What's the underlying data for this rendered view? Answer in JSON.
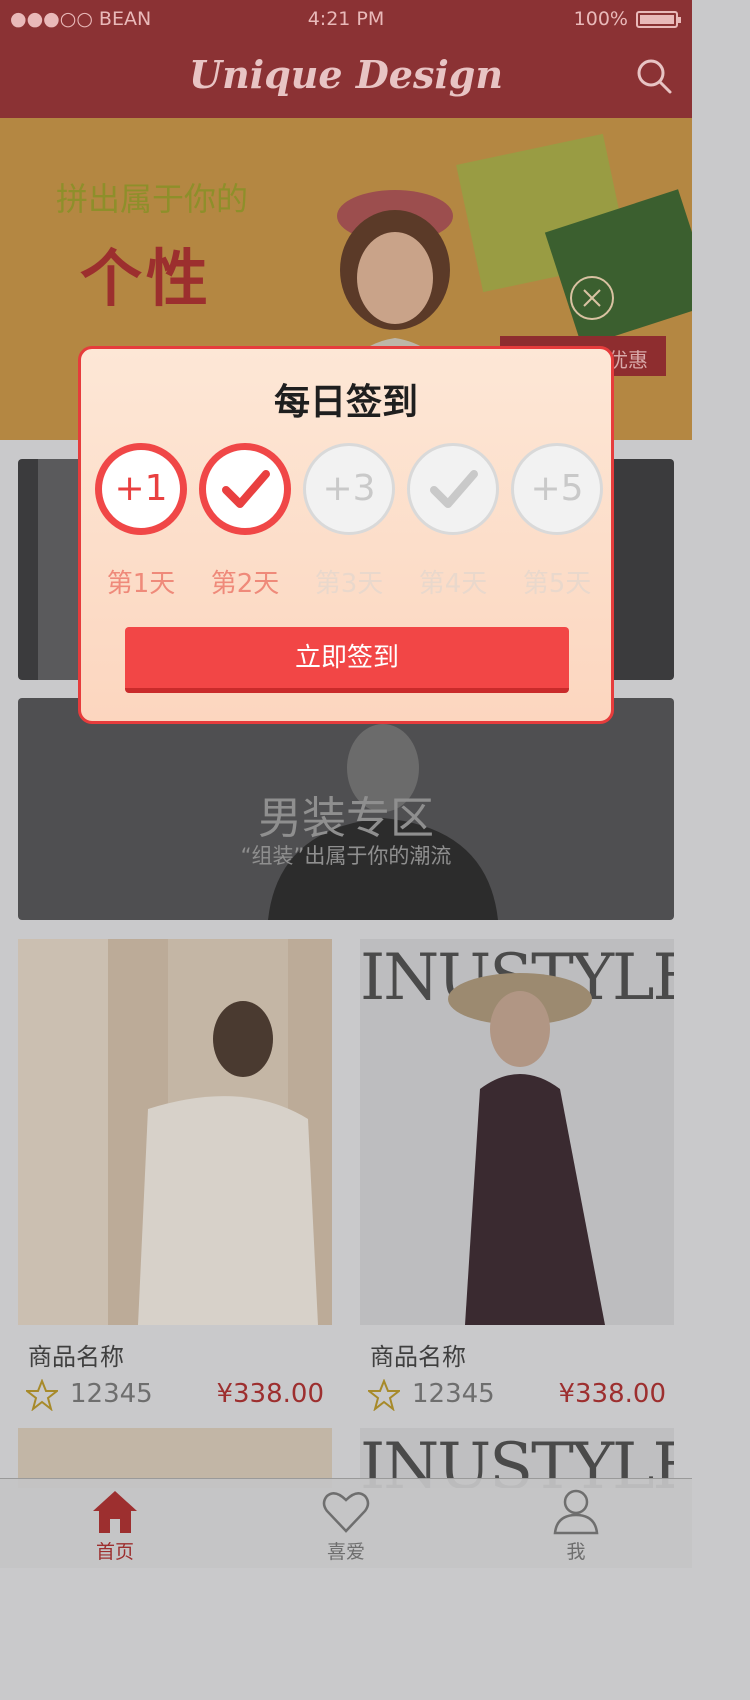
{
  "status_bar": {
    "carrier": "●●●○○ BEAN",
    "time": "4:21 PM",
    "battery": "100%"
  },
  "nav": {
    "title": "Unique Design",
    "search_icon": "search-icon"
  },
  "banner": {
    "headline": "拼出属于你的",
    "big_text": "个性",
    "tag": "优惠",
    "close_icon": "close-circle-icon"
  },
  "cards": {
    "mens": {
      "title": "男装专区",
      "subtitle": "“组装”出属于你的潮流"
    }
  },
  "products": [
    {
      "name": "商品名称",
      "count": "12345",
      "price": "¥338.00"
    },
    {
      "name": "商品名称",
      "count": "12345",
      "price": "¥338.00",
      "brand": "INUSTYLE"
    }
  ],
  "product_row2_brand": "INUSTYLE",
  "modal": {
    "title": "每日签到",
    "days": [
      {
        "label": "第1天",
        "badge": "+1",
        "state": "checked-in"
      },
      {
        "label": "第2天",
        "badge": "check",
        "state": "checked-in"
      },
      {
        "label": "第3天",
        "badge": "+3",
        "state": "pending"
      },
      {
        "label": "第4天",
        "badge": "check",
        "state": "pending"
      },
      {
        "label": "第5天",
        "badge": "+5",
        "state": "pending"
      }
    ],
    "button": "立即签到"
  },
  "tabbar": [
    {
      "label": "首页",
      "icon": "home-icon",
      "active": true
    },
    {
      "label": "喜爱",
      "icon": "heart-icon",
      "active": false
    },
    {
      "label": "我",
      "icon": "user-icon",
      "active": false
    }
  ],
  "colors": {
    "brand": "#8b3234",
    "accent": "#f24646",
    "price": "#9d2f2f"
  }
}
